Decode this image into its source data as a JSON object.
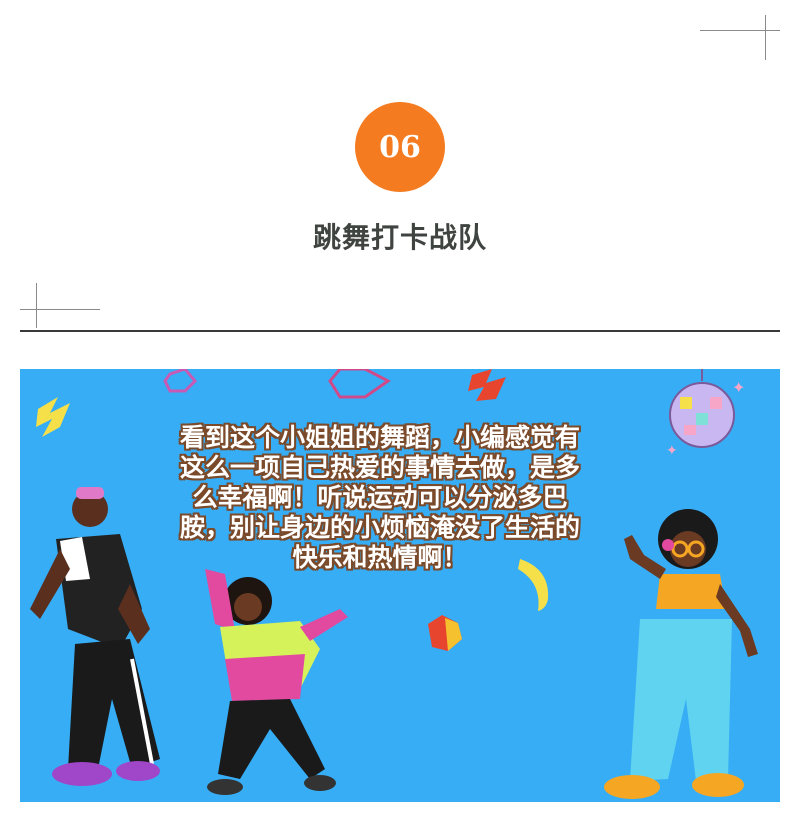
{
  "section": {
    "number": "06",
    "title": "跳舞打卡战队"
  },
  "illustration": {
    "caption_lines": [
      "看到这个小姐姐的舞蹈，小编感觉有",
      "这么一项自己热爱的事情去做，是多",
      "么幸福啊！听说运动可以分泌多巴",
      "胺，别让身边的小烦恼淹没了生活的",
      "快乐和热情啊！"
    ],
    "background_color": "#37adf5"
  },
  "colors": {
    "badge": "#f47b20",
    "title": "#3f4441",
    "divider": "#3a3a3a"
  }
}
